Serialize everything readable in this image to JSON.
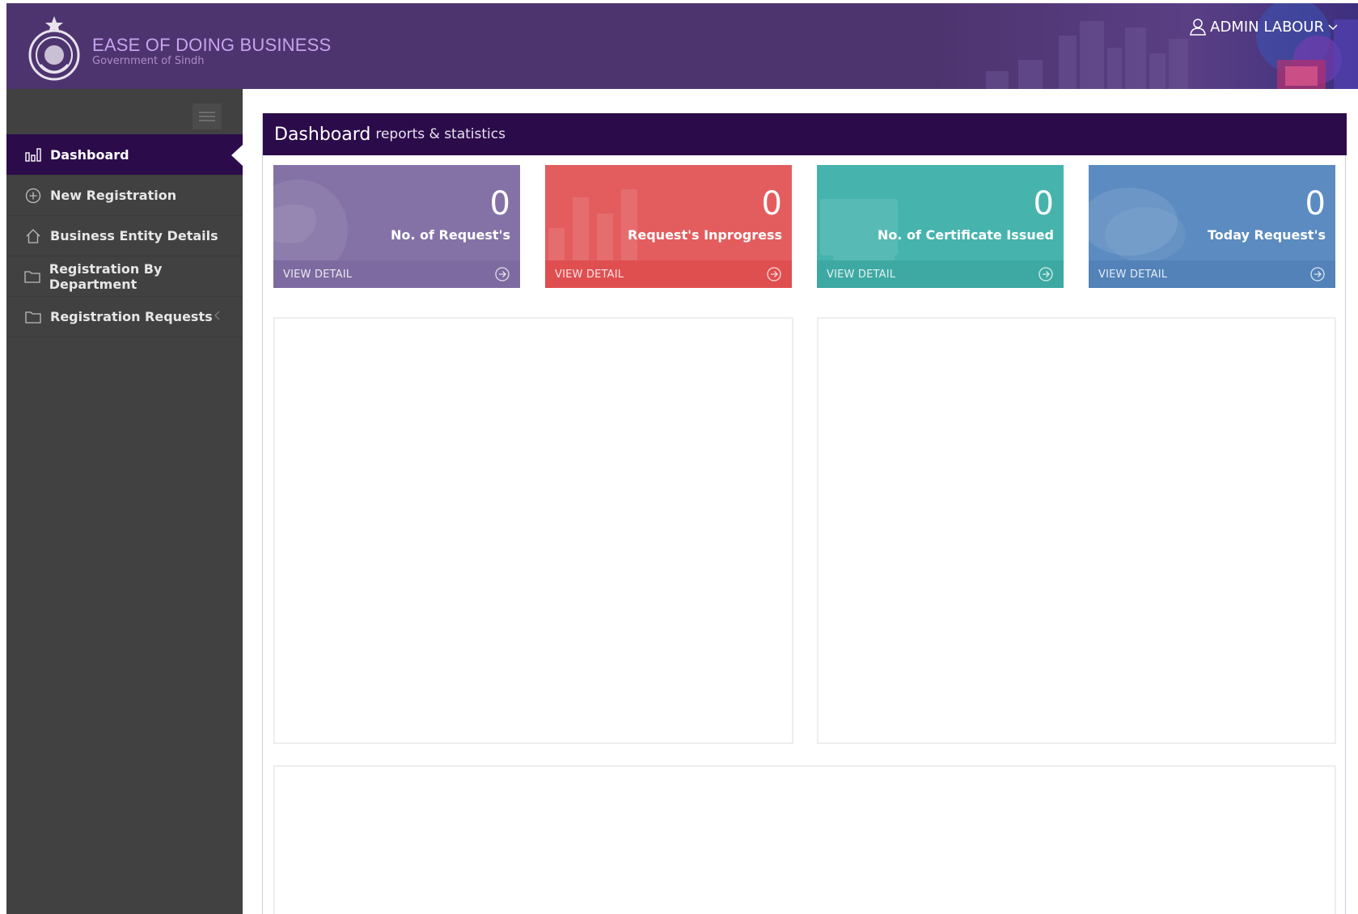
{
  "header": {
    "title": "EASE OF DOING BUSINESS",
    "subtitle": "Government of Sindh",
    "user_name": "ADMIN LABOUR",
    "bg_color": "#4e346f"
  },
  "sidebar": {
    "toggle_icon": "hamburger-icon",
    "items": [
      {
        "label": "Dashboard",
        "icon": "bar-chart-icon",
        "active": true
      },
      {
        "label": "New Registration",
        "icon": "plus-circle-icon",
        "active": false
      },
      {
        "label": "Business Entity Details",
        "icon": "home-icon",
        "active": false
      },
      {
        "label": "Registration By Department",
        "icon": "folder-icon",
        "active": false
      },
      {
        "label": "Registration Requests",
        "icon": "folder-icon",
        "active": false,
        "has_submenu": true
      }
    ]
  },
  "main": {
    "panel_title": "Dashboard",
    "panel_subtitle": "reports & statistics",
    "stats": [
      {
        "value": "0",
        "label": "No. of Request's",
        "footer": "VIEW DETAIL",
        "color": "#8472a7",
        "footer_color": "#7c6aa0"
      },
      {
        "value": "0",
        "label": "Request's Inprogress",
        "footer": "VIEW DETAIL",
        "color": "#e35d5e",
        "footer_color": "#df4f50"
      },
      {
        "value": "0",
        "label": "No. of Certificate Issued",
        "footer": "VIEW DETAIL",
        "color": "#46b3ad",
        "footer_color": "#3ea9a3"
      },
      {
        "value": "0",
        "label": "Today Request's",
        "footer": "VIEW DETAIL",
        "color": "#5b8bc0",
        "footer_color": "#5282b8"
      }
    ]
  },
  "colors": {
    "sidebar_bg": "#414141",
    "active_item": "#2c0b4b",
    "panel_header": "#2c0b4b"
  }
}
